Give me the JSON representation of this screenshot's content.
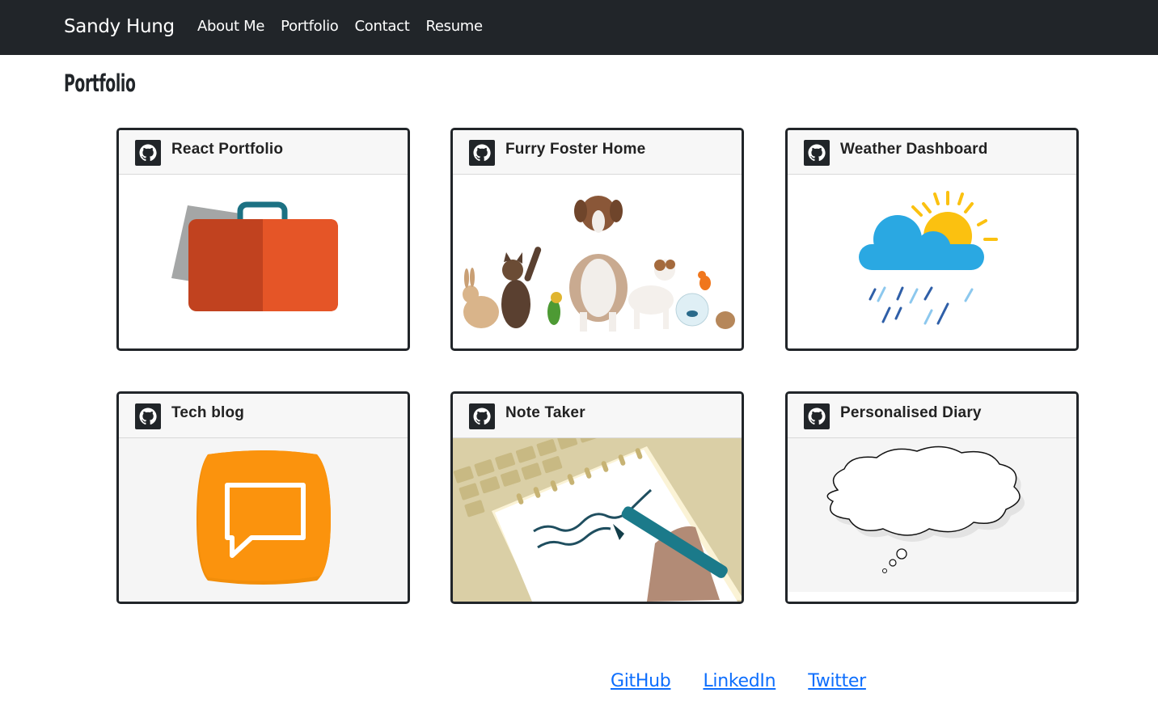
{
  "navbar": {
    "brand": "Sandy Hung",
    "links": [
      "About Me",
      "Portfolio",
      "Contact",
      "Resume"
    ]
  },
  "page": {
    "title": "Portfolio"
  },
  "cards": [
    {
      "title": "React Portfolio",
      "icon": "github-icon",
      "image": "briefcase"
    },
    {
      "title": "Furry Foster Home",
      "icon": "github-icon",
      "image": "pets"
    },
    {
      "title": "Weather Dashboard",
      "icon": "github-icon",
      "image": "weather"
    },
    {
      "title": "Tech blog",
      "icon": "github-icon",
      "image": "chat-bubble"
    },
    {
      "title": "Note Taker",
      "icon": "github-icon",
      "image": "notepad"
    },
    {
      "title": "Personalised Diary",
      "icon": "github-icon",
      "image": "thought-cloud"
    }
  ],
  "footer": {
    "links": [
      "GitHub",
      "LinkedIn",
      "Twitter"
    ]
  },
  "colors": {
    "navbar": "#212529",
    "link": "#0d6efd",
    "card_border": "#212529"
  }
}
